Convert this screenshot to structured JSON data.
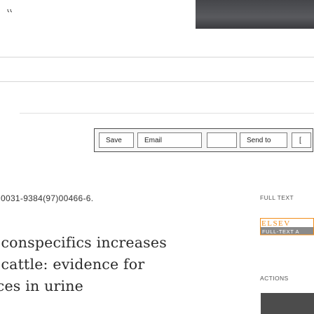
{
  "toolbar": {
    "save_label": "Save",
    "email_label": "Email",
    "send_to_label": "Send to",
    "more_label": "["
  },
  "article": {
    "doi": "0031-9384(97)00466-6.",
    "title_lines": [
      "l conspecifics increases",
      "ı cattle: evidence for",
      "ıces in urine"
    ]
  },
  "sidebar": {
    "full_text_label": "FULL TEXT",
    "publisher_logo_text": "ELSEV",
    "publisher_logo_subtext": "FULL-TEXT A",
    "actions_label": "ACTIONS"
  },
  "colors": {
    "header_image": "#4f5054",
    "toolbar_border": "#4e4e4e",
    "logo_orange": "#f28c18",
    "actions_bar": "#4c4c4c"
  }
}
